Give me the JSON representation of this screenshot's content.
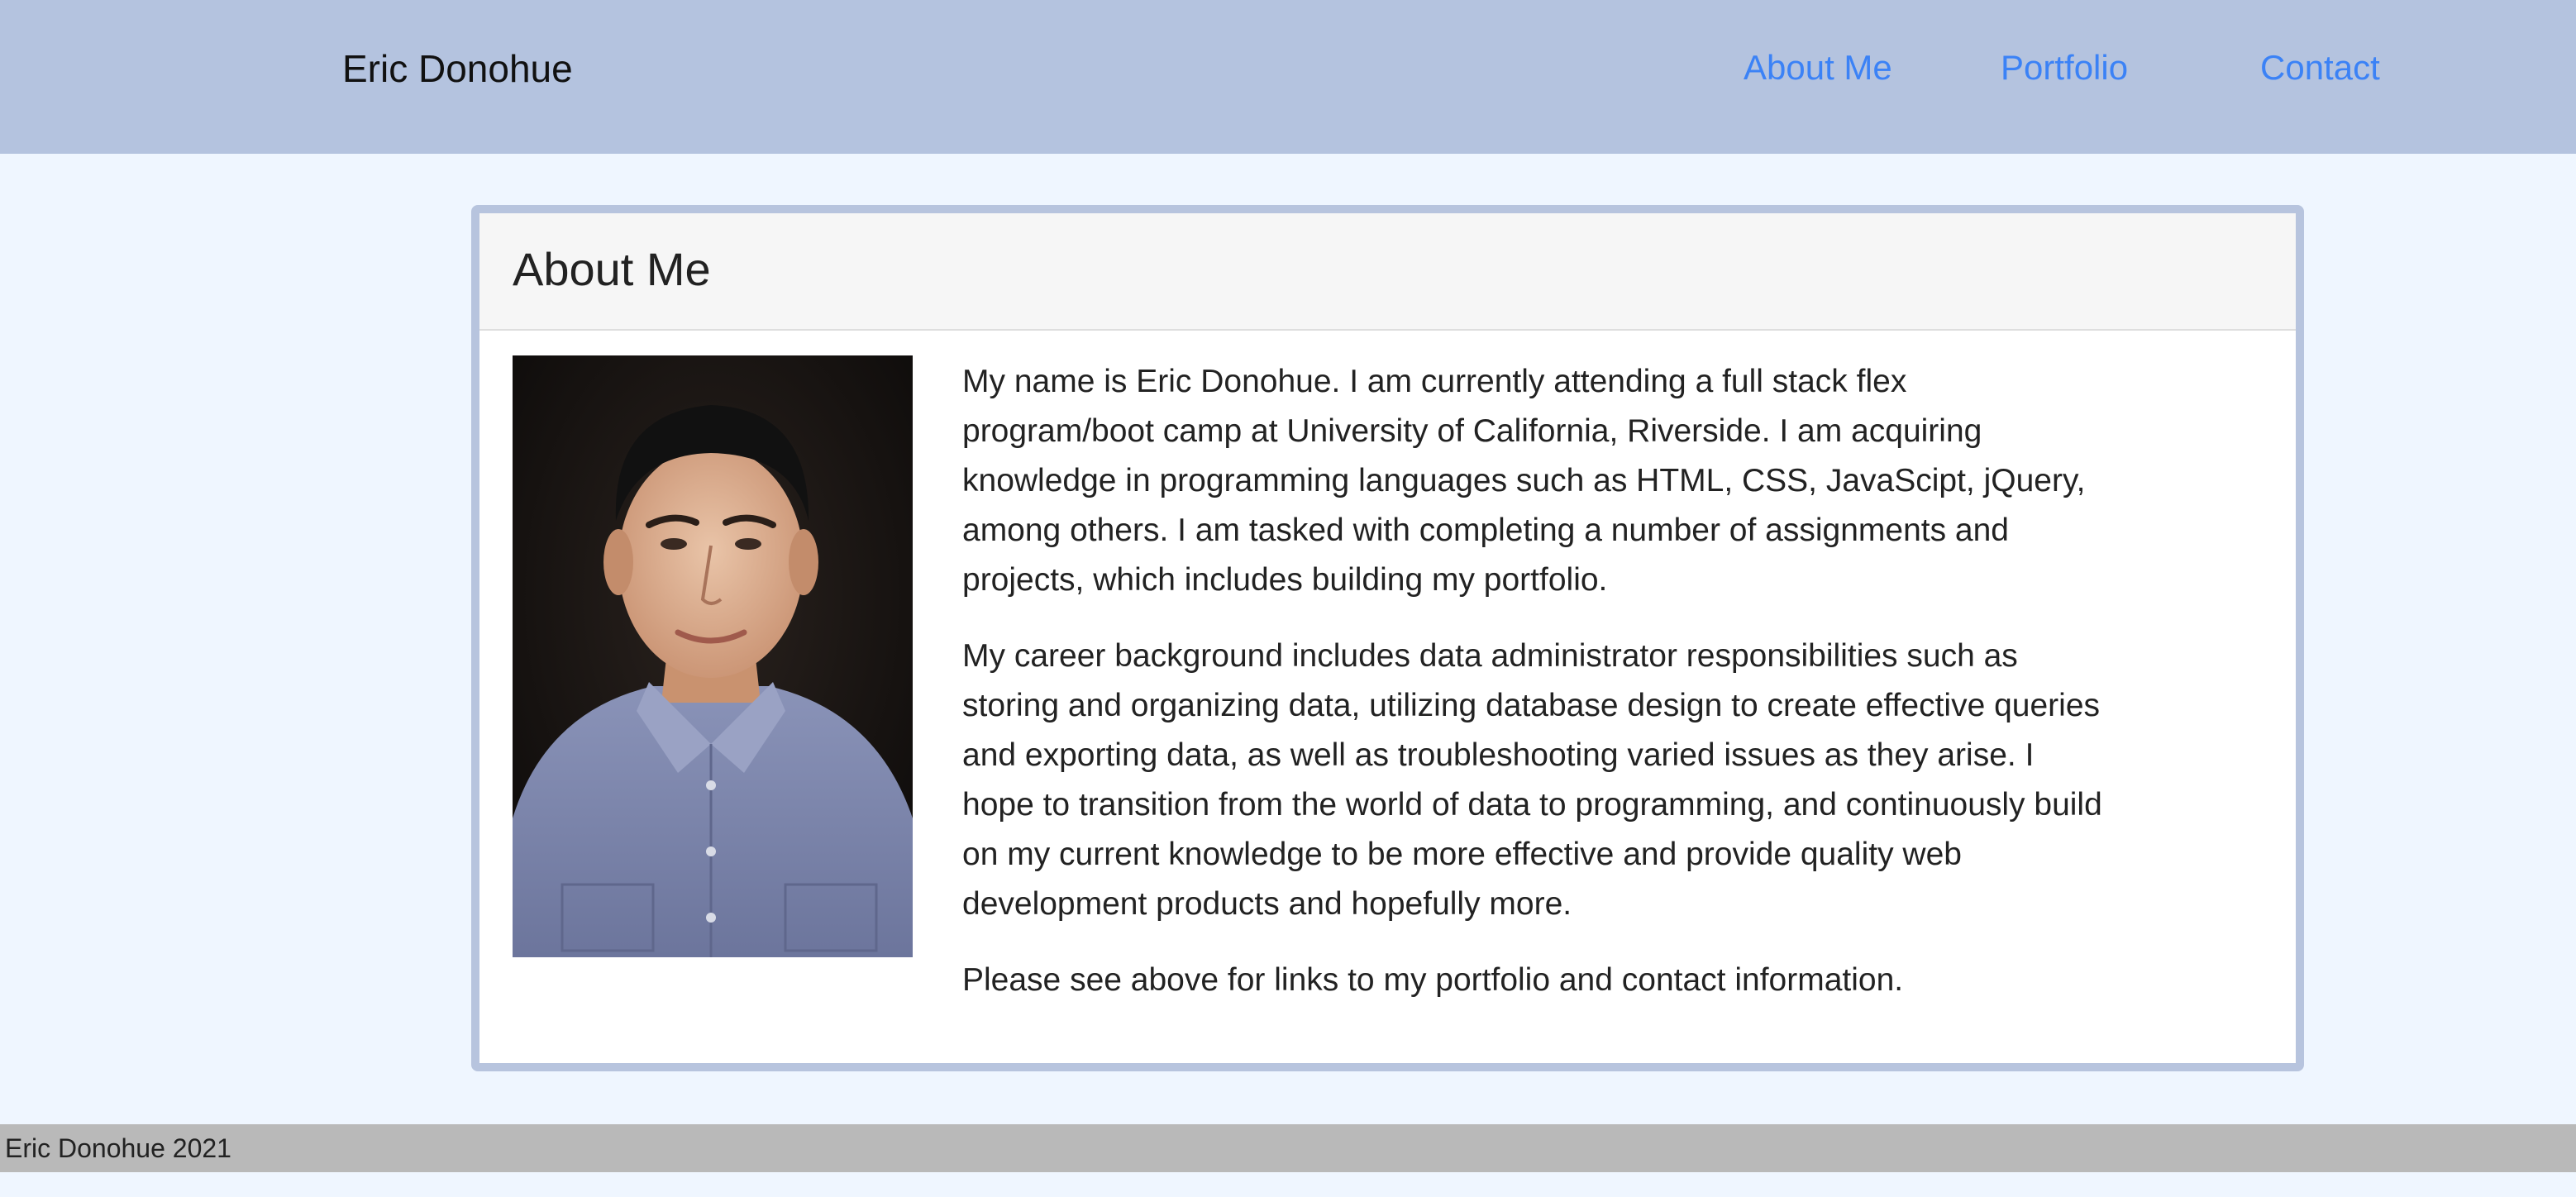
{
  "header": {
    "brand": "Eric Donohue",
    "nav": {
      "about": "About Me",
      "portfolio": "Portfolio",
      "contact": "Contact"
    }
  },
  "card": {
    "title": "About Me",
    "paragraphs": [
      "My name is Eric Donohue. I am currently attending a full stack flex program/boot camp at University of California, Riverside. I am acquiring knowledge in programming languages such as HTML, CSS, JavaScipt, jQuery, among others. I am tasked with completing a number of assignments and projects, which includes building my portfolio.",
      "My career background includes data administrator responsibilities such as storing and organizing data, utilizing database design to create effective queries and exporting data, as well as troubleshooting varied issues as they arise. I hope to transition from the world of data to programming, and continuously build on my current knowledge to be more effective and provide quality web development products and hopefully more.",
      "Please see above for links to my portfolio and contact information."
    ]
  },
  "footer": {
    "text": "Eric Donohue 2021"
  },
  "colors": {
    "header_bg": "#b4c3df",
    "page_bg": "#eff6ff",
    "link": "#3b82f6",
    "card_border": "#b7c4de",
    "footer_bg": "#b9b9b9"
  },
  "icons": {
    "portrait": "profile-photo"
  }
}
